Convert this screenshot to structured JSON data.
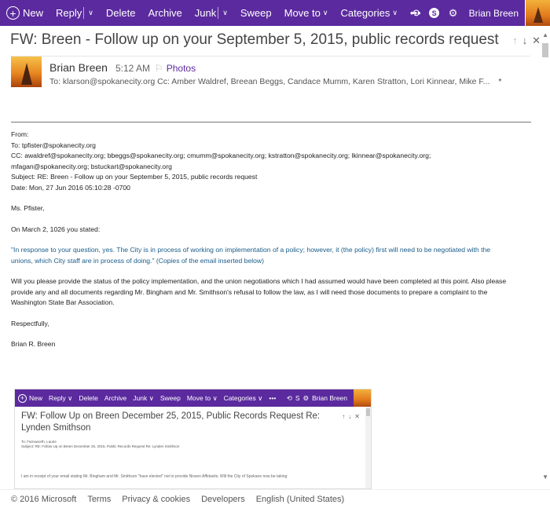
{
  "toolbar": {
    "new_label": "New",
    "reply_label": "Reply",
    "delete_label": "Delete",
    "archive_label": "Archive",
    "junk_label": "Junk",
    "sweep_label": "Sweep",
    "moveto_label": "Move to",
    "categories_label": "Categories",
    "more_label": "•••",
    "user_name": "Brian Breen",
    "icons": [
      "undo-icon",
      "skype-icon",
      "gear-icon",
      "avatar"
    ]
  },
  "message": {
    "subject": "FW: Breen - Follow up on your September 5, 2015, public records request",
    "sender": "Brian Breen",
    "time": "5:12 AM",
    "photos_link": "Photos",
    "recipients": "To: klarson@spokanecity.org Cc: Amber Waldref, Breean Beggs, Candace Mumm, Karen Stratton, Lori Kinnear, Mike F...",
    "expand": "*"
  },
  "body": {
    "from": "From:",
    "to": "To: tpfister@spokanecity.org",
    "cc1": "CC: awaldref@spokanecity.org; bbeggs@spokanecity.org; cmumm@spokanecity.org; kstratton@spokanecity.org; lkinnear@spokanecity.org;",
    "cc2": "mfagan@spokanecity.org; bstuckart@spokanecity.org",
    "subject": "Subject: RE: Breen - Follow up on your September 5, 2015, public records request",
    "date": "Date: Mon, 27 Jun 2016 05:10:28 -0700",
    "greeting": "Ms. Pfister,",
    "p1": "On March 2, 1026 you stated:",
    "quote1": " \"In response to your question, yes.  The City is in process of working on implementation of a policy; however, it (the policy) first will need to be negotiated with the",
    "quote2": "unions, which City staff are in process of doing.\"  (Copies of the email inserted below)",
    "p2a": "Will you please provide the status of the policy implementation, and the union negotiations which I had assumed would have been completed at this point. Also please",
    "p2b": "provide any and all documents regarding Mr. Bingham and Mr. Smithson's refusal to follow the law, as I will need those documents to prepare a complaint to the",
    "p2c": "Washington State Bar Association.",
    "closing": "Respectfully,",
    "signature": "Brian R. Breen"
  },
  "inset": {
    "new_label": "New",
    "reply_label": "Reply",
    "delete_label": "Delete",
    "archive_label": "Archive",
    "junk_label": "Junk",
    "sweep_label": "Sweep",
    "moveto_label": "Move to",
    "categories_label": "Categories",
    "more_label": "•••",
    "user_name": "Brian Breen",
    "subject": "FW: Follow Up on Breen December 25, 2015, Public Records Request Re: Lynden Smithson",
    "to": "To: Farnsworth, Laurie",
    "subj_line": "Subject: RE: Follow Up on Breen December 25, 2015, Public Records Request Re: Lynden Smithson",
    "body_line": "I am in  receipt of your email stating Mr. Bingham and Mr. Smithson \"have elected\" not to provide Nissen Affidavits. Will the City of Spokane now be taking"
  },
  "footer": {
    "copyright": "© 2016 Microsoft",
    "terms": "Terms",
    "privacy": "Privacy & cookies",
    "developers": "Developers",
    "language": "English (United States)"
  },
  "colors": {
    "toolbar_bg": "#5b2a9e",
    "link": "#5b2a9e",
    "quote": "#1a5c8a"
  }
}
